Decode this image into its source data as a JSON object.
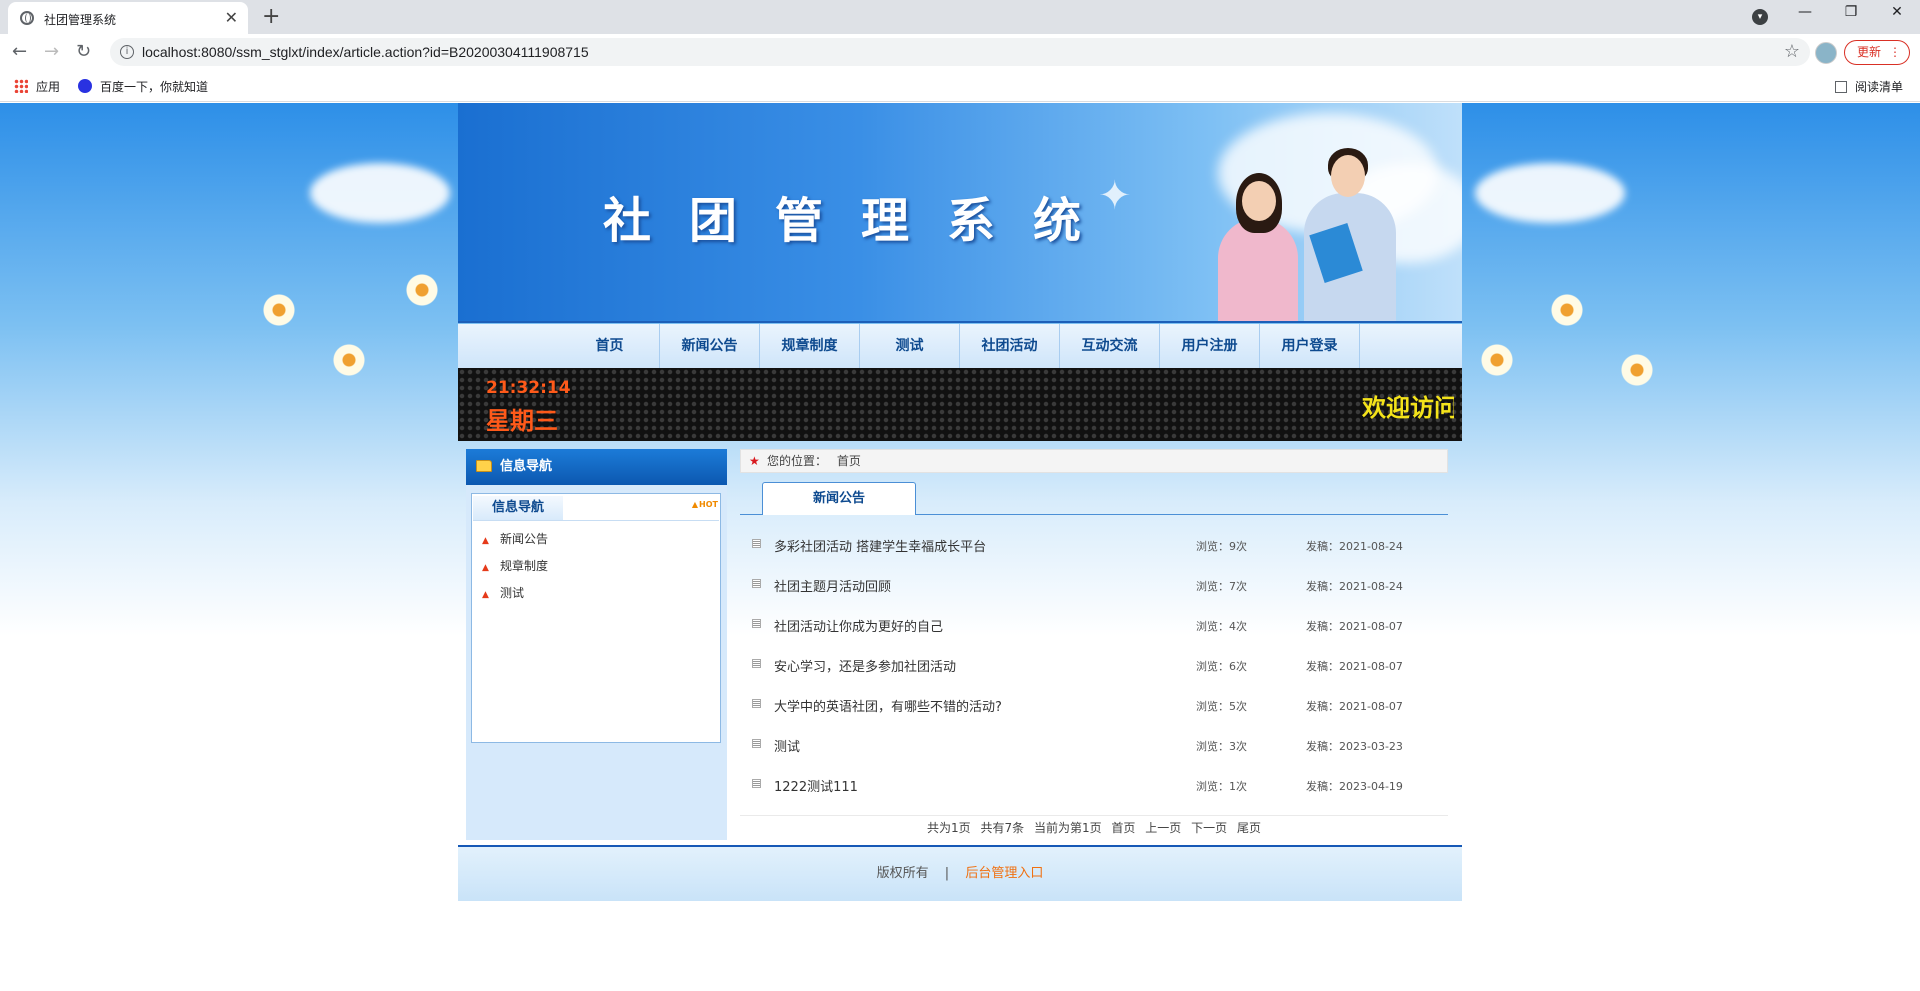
{
  "browser": {
    "tab_title": "社团管理系统",
    "url": "localhost:8080/ssm_stglxt/index/article.action?id=B20200304111908715",
    "update_label": "更新",
    "bookmarks": [
      "应用",
      "百度一下，你就知道"
    ],
    "reading_list": "阅读清单"
  },
  "site": {
    "banner_title": "社团管理系统",
    "menu": [
      "首页",
      "新闻公告",
      "规章制度",
      "测试",
      "社团活动",
      "互动交流",
      "用户注册",
      "用户登录"
    ],
    "clock": "21:32:14",
    "weekday": "星期三",
    "marquee": "欢迎访问"
  },
  "sidebar": {
    "title": "信息导航",
    "box_tab": "信息导航",
    "hot": "HOT",
    "links": [
      "新闻公告",
      "规章制度",
      "测试"
    ]
  },
  "main": {
    "breadcrumb_label": "您的位置：",
    "breadcrumb_value": "首页",
    "tab": "新闻公告",
    "articles": [
      {
        "title": "多彩社团活动 搭建学生幸福成长平台",
        "views": "浏览：9次",
        "date": "发稿：2021-08-24"
      },
      {
        "title": "社团主题月活动回顾",
        "views": "浏览：7次",
        "date": "发稿：2021-08-24"
      },
      {
        "title": "社团活动让你成为更好的自己",
        "views": "浏览：4次",
        "date": "发稿：2021-08-07"
      },
      {
        "title": "安心学习，还是多参加社团活动",
        "views": "浏览：6次",
        "date": "发稿：2021-08-07"
      },
      {
        "title": "大学中的英语社团，有哪些不错的活动?",
        "views": "浏览：5次",
        "date": "发稿：2021-08-07"
      },
      {
        "title": "测试",
        "views": "浏览：3次",
        "date": "发稿：2023-03-23"
      },
      {
        "title": "1222测试111",
        "views": "浏览：1次",
        "date": "发稿：2023-04-19"
      }
    ],
    "pager": {
      "total_pages": "共为1页",
      "total_items": "共有7条",
      "current": "当前为第1页",
      "first": "首页",
      "prev": "上一页",
      "next": "下一页",
      "last": "尾页"
    }
  },
  "footer": {
    "copyright": "版权所有",
    "separator": "|",
    "admin_link": "后台管理入口"
  },
  "colors": {
    "accent": "#0e4a8f",
    "clock": "#ff5a1a",
    "marquee": "#f4e31a",
    "admin_link": "#f07010"
  }
}
